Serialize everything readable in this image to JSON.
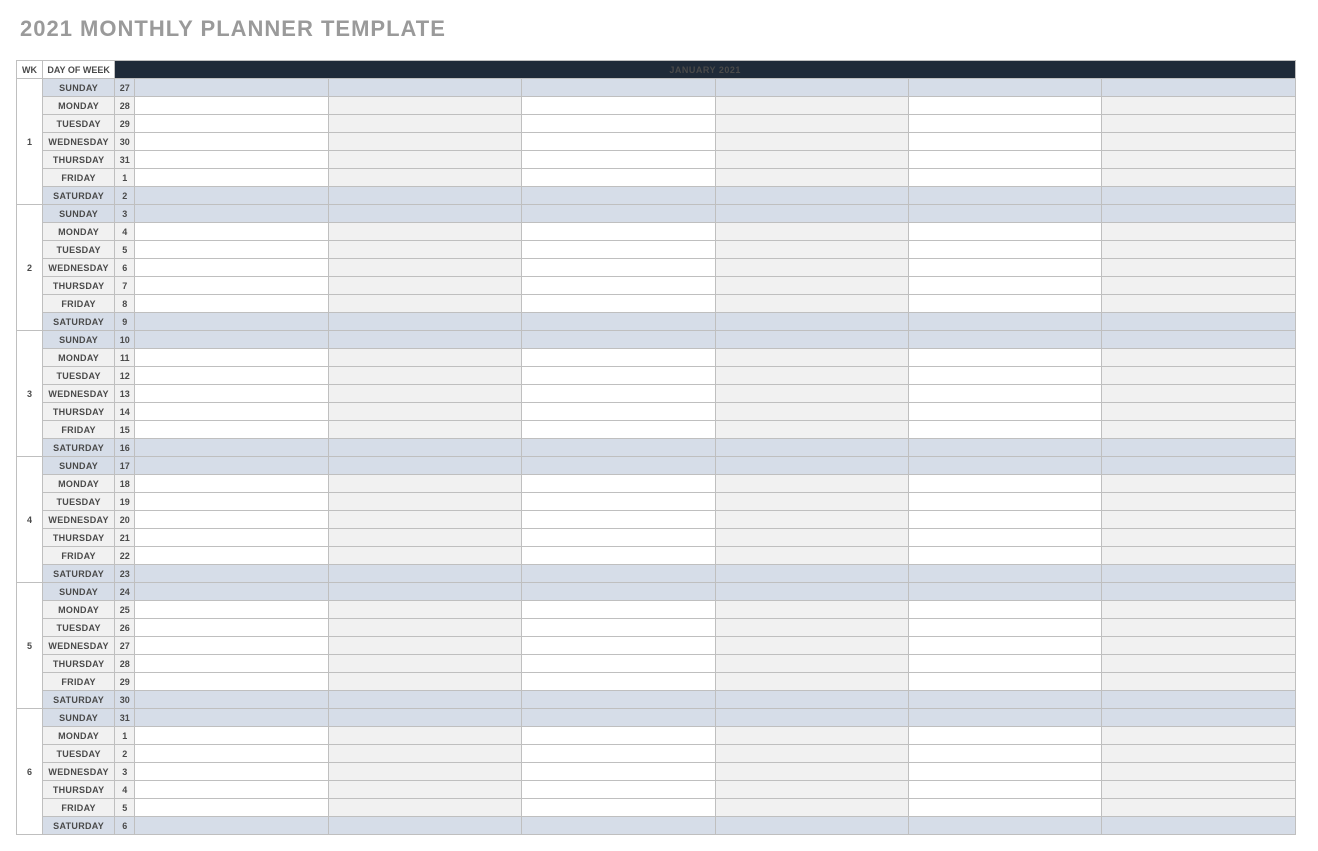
{
  "title": "2021 MONTHLY PLANNER TEMPLATE",
  "headers": {
    "wk": "WK",
    "dow": "DAY OF WEEK",
    "month": "JANUARY 2021"
  },
  "weeks": [
    {
      "num": "1",
      "days": [
        {
          "dow": "SUNDAY",
          "date": "27",
          "weekend": true
        },
        {
          "dow": "MONDAY",
          "date": "28",
          "weekend": false
        },
        {
          "dow": "TUESDAY",
          "date": "29",
          "weekend": false
        },
        {
          "dow": "WEDNESDAY",
          "date": "30",
          "weekend": false
        },
        {
          "dow": "THURSDAY",
          "date": "31",
          "weekend": false
        },
        {
          "dow": "FRIDAY",
          "date": "1",
          "weekend": false
        },
        {
          "dow": "SATURDAY",
          "date": "2",
          "weekend": true
        }
      ]
    },
    {
      "num": "2",
      "days": [
        {
          "dow": "SUNDAY",
          "date": "3",
          "weekend": true
        },
        {
          "dow": "MONDAY",
          "date": "4",
          "weekend": false
        },
        {
          "dow": "TUESDAY",
          "date": "5",
          "weekend": false
        },
        {
          "dow": "WEDNESDAY",
          "date": "6",
          "weekend": false
        },
        {
          "dow": "THURSDAY",
          "date": "7",
          "weekend": false
        },
        {
          "dow": "FRIDAY",
          "date": "8",
          "weekend": false
        },
        {
          "dow": "SATURDAY",
          "date": "9",
          "weekend": true
        }
      ]
    },
    {
      "num": "3",
      "days": [
        {
          "dow": "SUNDAY",
          "date": "10",
          "weekend": true
        },
        {
          "dow": "MONDAY",
          "date": "11",
          "weekend": false
        },
        {
          "dow": "TUESDAY",
          "date": "12",
          "weekend": false
        },
        {
          "dow": "WEDNESDAY",
          "date": "13",
          "weekend": false
        },
        {
          "dow": "THURSDAY",
          "date": "14",
          "weekend": false
        },
        {
          "dow": "FRIDAY",
          "date": "15",
          "weekend": false
        },
        {
          "dow": "SATURDAY",
          "date": "16",
          "weekend": true
        }
      ]
    },
    {
      "num": "4",
      "days": [
        {
          "dow": "SUNDAY",
          "date": "17",
          "weekend": true
        },
        {
          "dow": "MONDAY",
          "date": "18",
          "weekend": false
        },
        {
          "dow": "TUESDAY",
          "date": "19",
          "weekend": false
        },
        {
          "dow": "WEDNESDAY",
          "date": "20",
          "weekend": false
        },
        {
          "dow": "THURSDAY",
          "date": "21",
          "weekend": false
        },
        {
          "dow": "FRIDAY",
          "date": "22",
          "weekend": false
        },
        {
          "dow": "SATURDAY",
          "date": "23",
          "weekend": true
        }
      ]
    },
    {
      "num": "5",
      "days": [
        {
          "dow": "SUNDAY",
          "date": "24",
          "weekend": true
        },
        {
          "dow": "MONDAY",
          "date": "25",
          "weekend": false
        },
        {
          "dow": "TUESDAY",
          "date": "26",
          "weekend": false
        },
        {
          "dow": "WEDNESDAY",
          "date": "27",
          "weekend": false
        },
        {
          "dow": "THURSDAY",
          "date": "28",
          "weekend": false
        },
        {
          "dow": "FRIDAY",
          "date": "29",
          "weekend": false
        },
        {
          "dow": "SATURDAY",
          "date": "30",
          "weekend": true
        }
      ]
    },
    {
      "num": "6",
      "days": [
        {
          "dow": "SUNDAY",
          "date": "31",
          "weekend": true
        },
        {
          "dow": "MONDAY",
          "date": "1",
          "weekend": false
        },
        {
          "dow": "TUESDAY",
          "date": "2",
          "weekend": false
        },
        {
          "dow": "WEDNESDAY",
          "date": "3",
          "weekend": false
        },
        {
          "dow": "THURSDAY",
          "date": "4",
          "weekend": false
        },
        {
          "dow": "FRIDAY",
          "date": "5",
          "weekend": false
        },
        {
          "dow": "SATURDAY",
          "date": "6",
          "weekend": true
        }
      ]
    }
  ],
  "slot_count": 6
}
